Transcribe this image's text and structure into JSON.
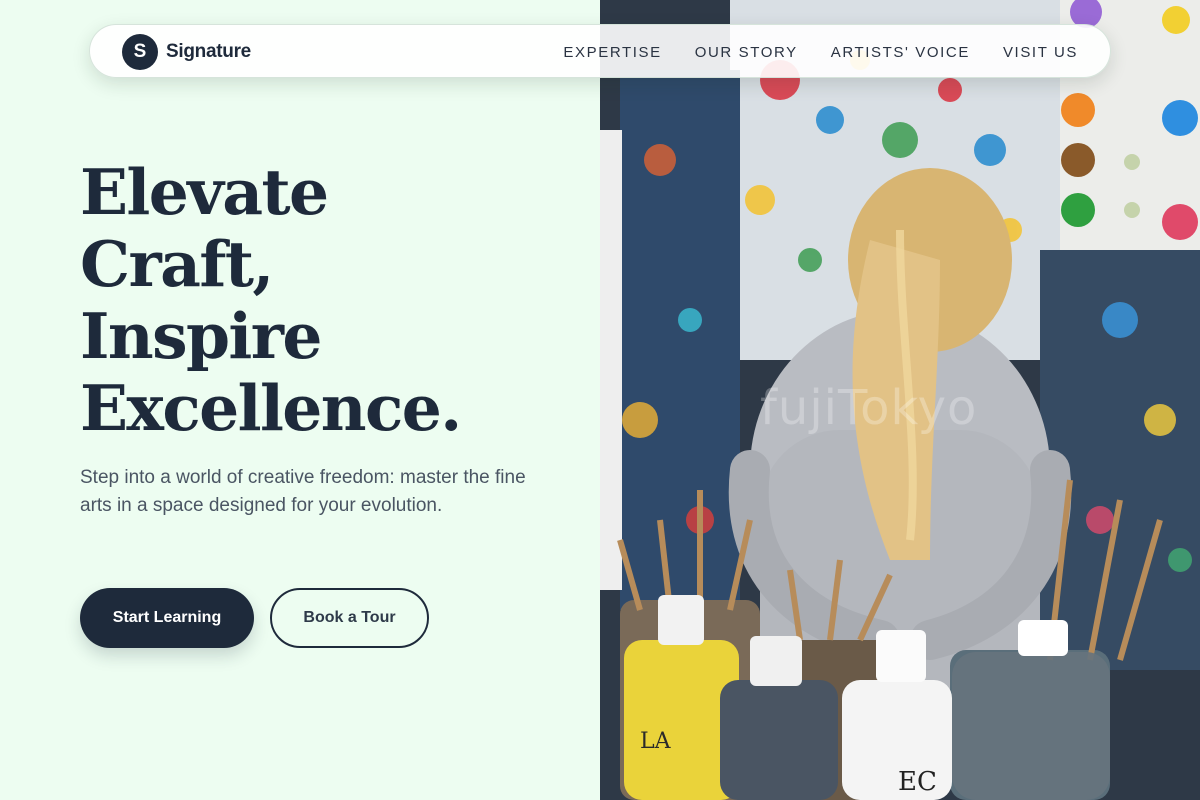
{
  "brand": {
    "badge_letter": "S",
    "name": "Signature"
  },
  "nav": {
    "items": [
      {
        "label": "EXPERTISE"
      },
      {
        "label": "OUR STORY"
      },
      {
        "label": "ARTISTS' VOICE"
      },
      {
        "label": "VISIT US"
      }
    ]
  },
  "hero": {
    "headline_lines": [
      "Elevate",
      "Craft,",
      "Inspire",
      "Excellence."
    ],
    "subtitle": "Step into a world of creative freedom: master the fine arts in a space designed for your evolution.",
    "primary_cta": "Start Learning",
    "secondary_cta": "Book a Tour"
  },
  "image": {
    "watermark": "fujiTokyo"
  },
  "colors": {
    "background": "#edfdf1",
    "primary": "#1e2a3b",
    "text_muted": "#4a5563"
  },
  "icons": {
    "logo": "letter-badge-icon"
  }
}
